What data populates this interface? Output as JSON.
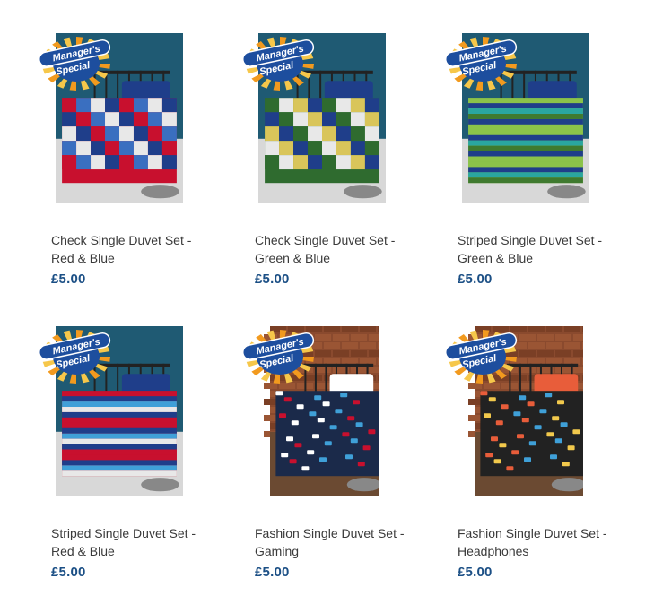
{
  "badge": {
    "line1": "Manager's",
    "line2": "Special",
    "colors": {
      "blue": "#1d4e9e",
      "orange": "#f29a1e",
      "ray": "#f6c74a",
      "white": "#ffffff"
    }
  },
  "products": [
    {
      "title_line1": "Check Single Duvet Set -",
      "title_line2": "Red & Blue",
      "price": "£5.00",
      "pattern": "check",
      "colors": {
        "wall": "#1f5a73",
        "c1": "#c8102e",
        "c2": "#1f3e8a",
        "c3": "#e8e8e8",
        "c4": "#3a6fc0"
      }
    },
    {
      "title_line1": "Check Single Duvet Set -",
      "title_line2": "Green & Blue",
      "price": "£5.00",
      "pattern": "check",
      "colors": {
        "wall": "#1f5a73",
        "c1": "#2f6b2f",
        "c2": "#1f3e8a",
        "c3": "#d9c55a",
        "c4": "#e8e8e8"
      }
    },
    {
      "title_line1": "Striped Single Duvet Set -",
      "title_line2": "Green & Blue",
      "price": "£5.00",
      "pattern": "stripe",
      "colors": {
        "wall": "#1f5a73",
        "c1": "#8bc34a",
        "c2": "#1f3e8a",
        "c3": "#2aa6a0",
        "c4": "#3f7a2f"
      }
    },
    {
      "title_line1": "Striped Single Duvet Set -",
      "title_line2": "Red & Blue",
      "price": "£5.00",
      "pattern": "stripe",
      "colors": {
        "wall": "#1f5a73",
        "c1": "#c8102e",
        "c2": "#1f3e8a",
        "c3": "#3fa0d8",
        "c4": "#e8e8e8"
      }
    },
    {
      "title_line1": "Fashion Single Duvet Set -",
      "title_line2": "Gaming",
      "price": "£5.00",
      "pattern": "dark",
      "colors": {
        "wall": "#8a4a2e",
        "c1": "#1b2a4a",
        "c2": "#ffffff",
        "c3": "#3fa0d8",
        "c4": "#c8102e"
      }
    },
    {
      "title_line1": "Fashion Single Duvet Set -",
      "title_line2": "Headphones",
      "price": "£5.00",
      "pattern": "dark",
      "colors": {
        "wall": "#8a4a2e",
        "c1": "#222222",
        "c2": "#e85d3a",
        "c3": "#3fa0d8",
        "c4": "#f2c94c"
      }
    }
  ]
}
